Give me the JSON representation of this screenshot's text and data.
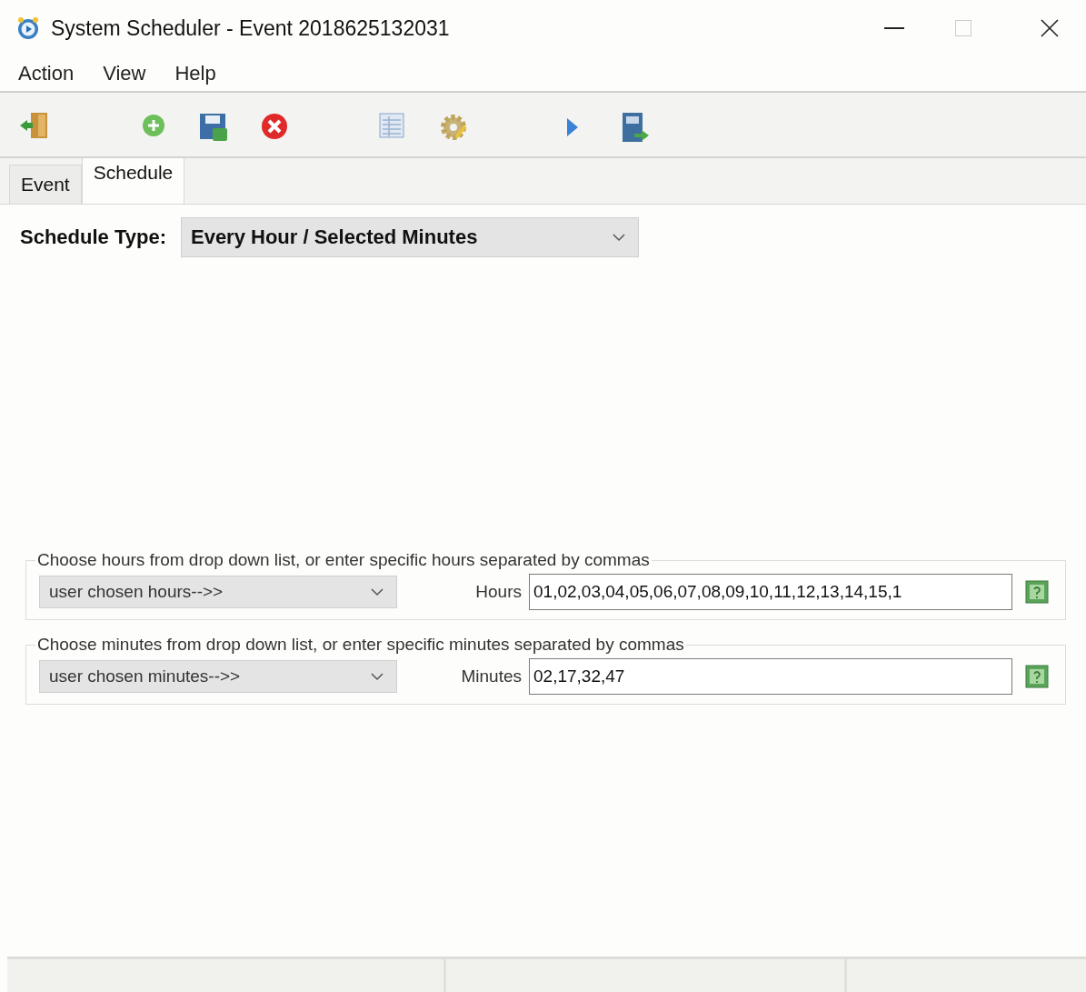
{
  "window": {
    "title": "System Scheduler - Event 2018625132031"
  },
  "menu": [
    "Action",
    "View",
    "Help"
  ],
  "tabs": [
    {
      "label": "Event",
      "selected": false
    },
    {
      "label": "Schedule",
      "selected": true
    }
  ],
  "schedule_type": {
    "label": "Schedule Type:",
    "value": "Every Hour / Selected Minutes"
  },
  "groups": [
    {
      "legend": "Choose hours from drop down list, or enter specific hours separated by commas",
      "dropdown": "user chosen hours-->>",
      "field_label": "Hours",
      "value": "01,02,03,04,05,06,07,08,09,10,11,12,13,14,15,1"
    },
    {
      "legend": "Choose minutes from drop down list, or enter specific minutes separated by commas",
      "dropdown": "user chosen minutes-->>",
      "field_label": "Minutes",
      "value": "02,17,32,47"
    }
  ]
}
